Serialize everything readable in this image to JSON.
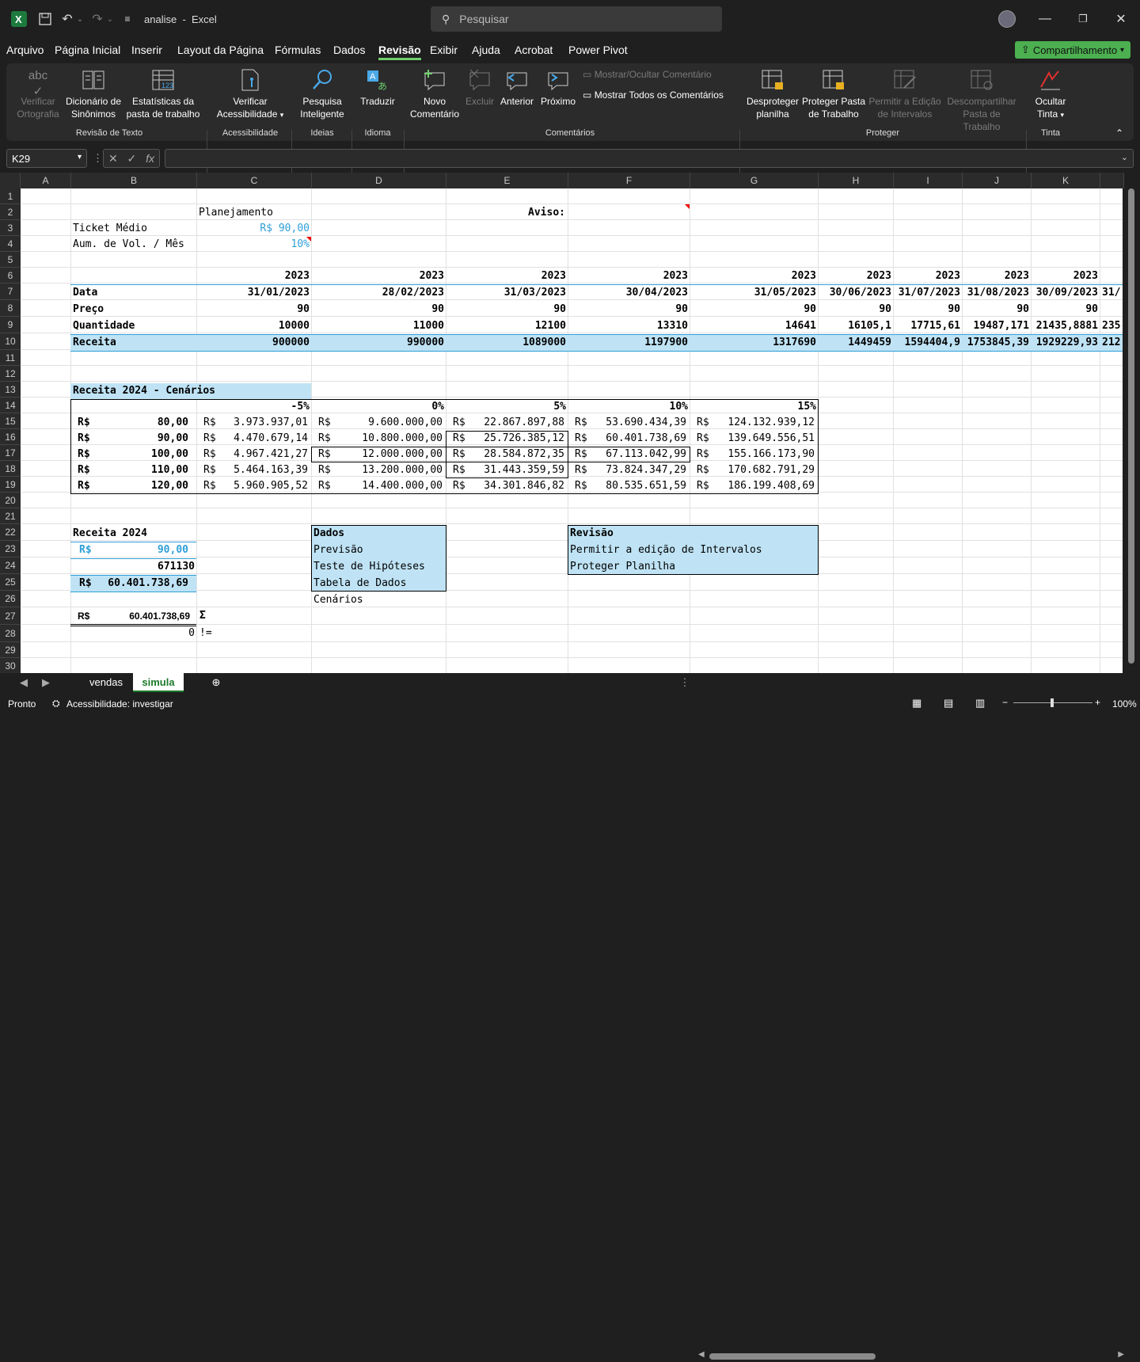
{
  "titlebar": {
    "filename": "analise",
    "separator": "-",
    "app": "Excel",
    "search_placeholder": "Pesquisar"
  },
  "menu": [
    "Arquivo",
    "Página Inicial",
    "Inserir",
    "Layout da Página",
    "Fórmulas",
    "Dados",
    "Revisão",
    "Exibir",
    "Ajuda",
    "Acrobat",
    "Power Pivot"
  ],
  "share_label": "Compartilhamento",
  "ribbon": {
    "buttons": {
      "spelling": [
        "Verificar",
        "Ortografia"
      ],
      "thesaurus": [
        "Dicionário de",
        "Sinônimos"
      ],
      "stats": [
        "Estatísticas da",
        "pasta de trabalho"
      ],
      "access": [
        "Verificar",
        "Acessibilidade"
      ],
      "smart": [
        "Pesquisa",
        "Inteligente"
      ],
      "translate": [
        "Traduzir"
      ],
      "newcomment": [
        "Novo",
        "Comentário"
      ],
      "delete": [
        "Excluir"
      ],
      "prev": [
        "Anterior"
      ],
      "next": [
        "Próximo"
      ],
      "showhide": "Mostrar/Ocultar Comentário",
      "showall": "Mostrar Todos os Comentários",
      "unprotect": [
        "Desproteger",
        "planilha"
      ],
      "protectwb": [
        "Proteger Pasta",
        "de Trabalho"
      ],
      "allowedit": [
        "Permitir a Edição",
        "de Intervalos"
      ],
      "unshare": [
        "Descompartilhar",
        "Pasta de Trabalho"
      ],
      "hideink": [
        "Ocultar",
        "Tinta"
      ]
    },
    "groups": {
      "review": "Revisão de Texto",
      "access": "Acessibilidade",
      "ideas": "Ideias",
      "lang": "Idioma",
      "comments": "Comentários",
      "protect": "Proteger",
      "ink": "Tinta"
    }
  },
  "formula": {
    "namebox": "K29",
    "fx": "fx",
    "content": ""
  },
  "columns": [
    "A",
    "B",
    "C",
    "D",
    "E",
    "F",
    "G",
    "H",
    "I",
    "J",
    "K"
  ],
  "rows": [
    "1",
    "2",
    "3",
    "4",
    "5",
    "6",
    "7",
    "8",
    "9",
    "10",
    "11",
    "12",
    "13",
    "14",
    "15",
    "16",
    "17",
    "18",
    "19",
    "20",
    "21",
    "22",
    "23",
    "24",
    "25",
    "26",
    "27",
    "28",
    "29",
    "30"
  ],
  "cells": {
    "c2": "Planejamento",
    "e2": "Aviso:",
    "b3": "Ticket Médio",
    "c3": "R$ 90,00",
    "b4": "Aum. de Vol. / Mês",
    "c4": "10%",
    "year": "2023",
    "b7": "Data",
    "b8": "Preço",
    "b9": "Quantidade",
    "b10": "Receita",
    "dates": [
      "31/01/2023",
      "28/02/2023",
      "31/03/2023",
      "30/04/2023",
      "31/05/2023",
      "30/06/2023",
      "31/07/2023",
      "31/08/2023",
      "30/09/2023",
      "31/"
    ],
    "prices": [
      "90",
      "90",
      "90",
      "90",
      "90",
      "90",
      "90",
      "90",
      "90"
    ],
    "qty": [
      "10000",
      "11000",
      "12100",
      "13310",
      "14641",
      "16105,1",
      "17715,61",
      "19487,171",
      "21435,8881",
      "235"
    ],
    "receita": [
      "900000",
      "990000",
      "1089000",
      "1197900",
      "1317690",
      "1449459",
      "1594404,9",
      "1753845,39",
      "1929229,93",
      "212"
    ],
    "b13": "Receita 2024 - Cenários",
    "pct": [
      "-5%",
      "0%",
      "5%",
      "10%",
      "15%"
    ],
    "rs": "R$",
    "prices_s": [
      "80,00",
      "90,00",
      "100,00",
      "110,00",
      "120,00"
    ],
    "grid": [
      [
        "3.973.937,01",
        "9.600.000,00",
        "22.867.897,88",
        "53.690.434,39",
        "124.132.939,12"
      ],
      [
        "4.470.679,14",
        "10.800.000,00",
        "25.726.385,12",
        "60.401.738,69",
        "139.649.556,51"
      ],
      [
        "4.967.421,27",
        "12.000.000,00",
        "28.584.872,35",
        "67.113.042,99",
        "155.166.173,90"
      ],
      [
        "5.464.163,39",
        "13.200.000,00",
        "31.443.359,59",
        "73.824.347,29",
        "170.682.791,29"
      ],
      [
        "5.960.905,52",
        "14.400.000,00",
        "34.301.846,82",
        "80.535.651,59",
        "186.199.408,69"
      ]
    ],
    "b22": "Receita 2024",
    "b23": "90,00",
    "b24": "671130",
    "b25": "60.401.738,69",
    "b27": "60.401.738,69",
    "c27": "Σ",
    "b28": "0",
    "c28": "!=",
    "d22": "Dados",
    "d23": "Previsão",
    "d24": "Teste de Hipóteses",
    "d25": "Tabela de Dados",
    "d26": "Cenários",
    "f22": "Revisão",
    "f23": "Permitir a edição de Intervalos",
    "f24": "Proteger Planilha"
  },
  "tabs": {
    "sheets": [
      "vendas",
      "simula"
    ],
    "active": "simula"
  },
  "status": {
    "ready": "Pronto",
    "access": "Acessibilidade: investigar",
    "zoom": "100%"
  },
  "colors": {
    "accent": "#4caf50",
    "blue_text": "#2e9fd8",
    "highlight": "#bfe3f5"
  }
}
